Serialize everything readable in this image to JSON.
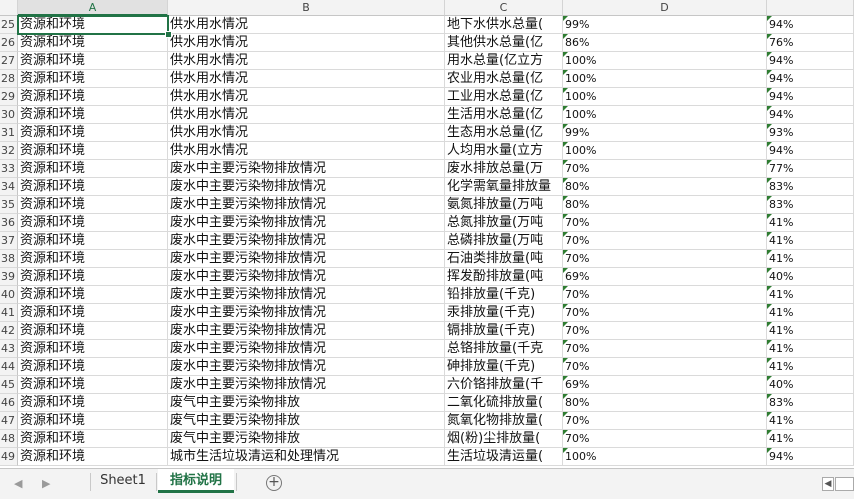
{
  "columns": [
    "A",
    "B",
    "C",
    "D"
  ],
  "rows": [
    {
      "n": "25",
      "a": "资源和环境",
      "b": "供水用水情况",
      "c": "地下水供水总量(",
      "d": "99%",
      "e": "94%"
    },
    {
      "n": "26",
      "a": "资源和环境",
      "b": "供水用水情况",
      "c": "其他供水总量(亿",
      "d": "86%",
      "e": "76%"
    },
    {
      "n": "27",
      "a": "资源和环境",
      "b": "供水用水情况",
      "c": "用水总量(亿立方",
      "d": "100%",
      "e": "94%"
    },
    {
      "n": "28",
      "a": "资源和环境",
      "b": "供水用水情况",
      "c": "农业用水总量(亿",
      "d": "100%",
      "e": "94%"
    },
    {
      "n": "29",
      "a": "资源和环境",
      "b": "供水用水情况",
      "c": "工业用水总量(亿",
      "d": "100%",
      "e": "94%"
    },
    {
      "n": "30",
      "a": "资源和环境",
      "b": "供水用水情况",
      "c": "生活用水总量(亿",
      "d": "100%",
      "e": "94%"
    },
    {
      "n": "31",
      "a": "资源和环境",
      "b": "供水用水情况",
      "c": "生态用水总量(亿",
      "d": "99%",
      "e": "93%"
    },
    {
      "n": "32",
      "a": "资源和环境",
      "b": "供水用水情况",
      "c": "人均用水量(立方",
      "d": "100%",
      "e": "94%"
    },
    {
      "n": "33",
      "a": "资源和环境",
      "b": "废水中主要污染物排放情况",
      "c": "废水排放总量(万",
      "d": "70%",
      "e": "77%"
    },
    {
      "n": "34",
      "a": "资源和环境",
      "b": "废水中主要污染物排放情况",
      "c": "化学需氧量排放量",
      "d": "80%",
      "e": "83%"
    },
    {
      "n": "35",
      "a": "资源和环境",
      "b": "废水中主要污染物排放情况",
      "c": "氨氮排放量(万吨",
      "d": "80%",
      "e": "83%"
    },
    {
      "n": "36",
      "a": "资源和环境",
      "b": "废水中主要污染物排放情况",
      "c": "总氮排放量(万吨",
      "d": "70%",
      "e": "41%"
    },
    {
      "n": "37",
      "a": "资源和环境",
      "b": "废水中主要污染物排放情况",
      "c": "总磷排放量(万吨",
      "d": "70%",
      "e": "41%"
    },
    {
      "n": "38",
      "a": "资源和环境",
      "b": "废水中主要污染物排放情况",
      "c": "石油类排放量(吨",
      "d": "70%",
      "e": "41%"
    },
    {
      "n": "39",
      "a": "资源和环境",
      "b": "废水中主要污染物排放情况",
      "c": "挥发酚排放量(吨",
      "d": "69%",
      "e": "40%"
    },
    {
      "n": "40",
      "a": "资源和环境",
      "b": "废水中主要污染物排放情况",
      "c": "铅排放量(千克)",
      "d": "70%",
      "e": "41%"
    },
    {
      "n": "41",
      "a": "资源和环境",
      "b": "废水中主要污染物排放情况",
      "c": "汞排放量(千克)",
      "d": "70%",
      "e": "41%"
    },
    {
      "n": "42",
      "a": "资源和环境",
      "b": "废水中主要污染物排放情况",
      "c": "镉排放量(千克)",
      "d": "70%",
      "e": "41%"
    },
    {
      "n": "43",
      "a": "资源和环境",
      "b": "废水中主要污染物排放情况",
      "c": "总铬排放量(千克",
      "d": "70%",
      "e": "41%"
    },
    {
      "n": "44",
      "a": "资源和环境",
      "b": "废水中主要污染物排放情况",
      "c": "砷排放量(千克)",
      "d": "70%",
      "e": "41%"
    },
    {
      "n": "45",
      "a": "资源和环境",
      "b": "废水中主要污染物排放情况",
      "c": "六价铬排放量(千",
      "d": "69%",
      "e": "40%"
    },
    {
      "n": "46",
      "a": "资源和环境",
      "b": "废气中主要污染物排放",
      "c": "二氧化硫排放量(",
      "d": "80%",
      "e": "83%"
    },
    {
      "n": "47",
      "a": "资源和环境",
      "b": "废气中主要污染物排放",
      "c": "氮氧化物排放量(",
      "d": "70%",
      "e": "41%"
    },
    {
      "n": "48",
      "a": "资源和环境",
      "b": "废气中主要污染物排放",
      "c": "烟(粉)尘排放量(",
      "d": "70%",
      "e": "41%"
    },
    {
      "n": "49",
      "a": "资源和环境",
      "b": "城市生活垃圾清运和处理情况",
      "c": "生活垃圾清运量(",
      "d": "100%",
      "e": "94%"
    }
  ],
  "tabs": [
    {
      "label": "Sheet1",
      "active": false
    },
    {
      "label": "指标说明",
      "active": true
    }
  ],
  "add_sheet": "+",
  "nav_prev": "◀",
  "nav_next": "▶",
  "accent": "#217346"
}
